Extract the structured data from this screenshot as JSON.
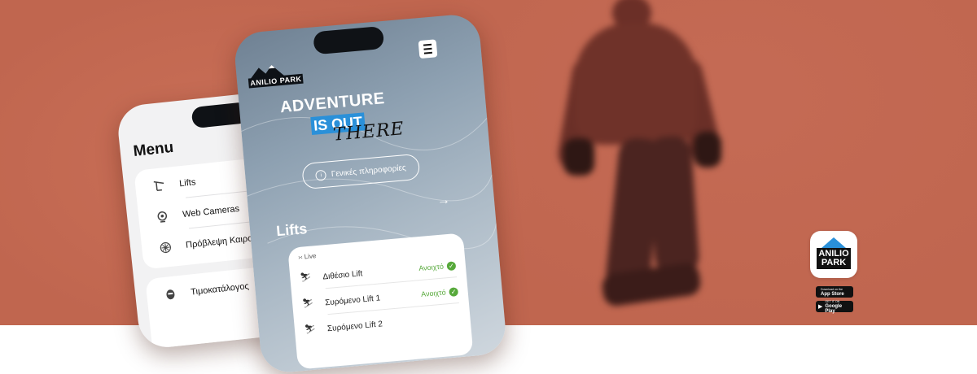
{
  "brand": {
    "logo_text": "ANILIO PARK",
    "accent": "#2a90d9",
    "background": "#c0664f"
  },
  "menu_screen": {
    "title": "Menu",
    "items": [
      {
        "label": "Lifts",
        "icon": "ski-lift-icon"
      },
      {
        "label": "Web Cameras",
        "icon": "webcam-icon"
      },
      {
        "label": "Πρόβλεψη Καιρού",
        "icon": "snowflake-icon"
      },
      {
        "label": "Τιμοκατάλογος",
        "icon": "ski-mask-icon"
      }
    ]
  },
  "home_screen": {
    "headline_line1": "ADVENTURE",
    "headline_line2": "IS OUT",
    "headline_line3": "THERE",
    "info_button": "Γενικές πληροφορίες",
    "lifts_title": "Lifts",
    "live_label": "Live",
    "lifts": [
      {
        "name": "Διθέσιο Lift",
        "status": "Ανοιχτό"
      },
      {
        "name": "Συρόμενο Lift 1",
        "status": "Ανοιχτό"
      },
      {
        "name": "Συρόμενο Lift 2",
        "status": ""
      }
    ],
    "status_color": "#57a93b"
  },
  "store_badges": {
    "app_icon_text_1": "ANILIO",
    "app_icon_text_2": "PARK",
    "apple_small": "Download on the",
    "apple_large": "App Store",
    "google_small": "GET IT ON",
    "google_large": "Google Play"
  }
}
